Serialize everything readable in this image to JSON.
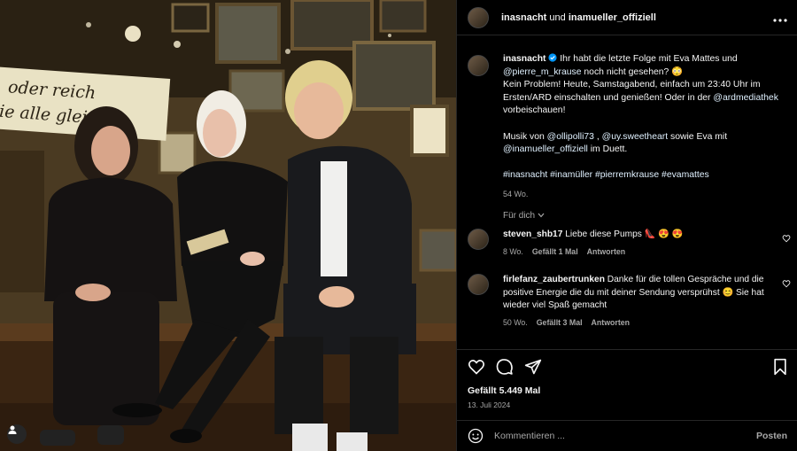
{
  "header": {
    "account_1": "inasnacht",
    "conjunction": "und",
    "account_2": "inamueller_offiziell",
    "more_icon": "ellipsis-icon"
  },
  "photo": {
    "sign_line_1": "oder reich",
    "sign_line_2": "ie alle gleich",
    "user_tag_icon": "user-icon"
  },
  "caption": {
    "username": "inasnacht",
    "part1": " Ihr habt die letzte Folge mit Eva Mattes und ",
    "mention1": "@pierre_m_krause",
    "part2": " noch nicht gesehen? 😳",
    "line2": "Kein Problem! Heute, Samstagabend, einfach um 23:40 Uhr im Ersten/ARD einschalten und genießen! Oder in der ",
    "mention2": "@ardmediathek",
    "line2_end": " vorbeischauen!",
    "music_prefix": "Musik von ",
    "mention3": "@ollipolli73",
    "comma": " , ",
    "mention4": "@uy.sweetheart",
    "music_mid": " sowie Eva mit ",
    "mention5": "@inamueller_offiziell",
    "music_end": " im Duett.",
    "hashtags": "#inasnacht #inamüller #pierremkrause #evamattes",
    "time": "54 Wo.",
    "see_translation": "Für dich"
  },
  "comments": [
    {
      "username": "steven_shb17",
      "text": " Liebe diese Pumps 👠 😍 😍",
      "time": "8 Wo.",
      "likes": "Gefällt 1 Mal",
      "reply": "Antworten"
    },
    {
      "username": "firlefanz_zaubertrunken",
      "text": " Danke für die tollen Gespräche und die positive Energie die du mit deiner Sendung versprühst 😊 Sie hat wieder viel Spaß gemacht",
      "time": "50 Wo.",
      "likes": "Gefällt 3 Mal",
      "reply": "Antworten"
    }
  ],
  "actions": {
    "likes": "Gefällt 5.449 Mal",
    "date": "13. Juli 2024"
  },
  "comment_box": {
    "placeholder": "Kommentieren ...",
    "post_label": "Posten"
  },
  "colors": {
    "background": "#000000",
    "text": "#f5f5f5",
    "secondary_text": "#a8a8a8",
    "link": "#e0f1ff",
    "verified": "#0095f6"
  }
}
